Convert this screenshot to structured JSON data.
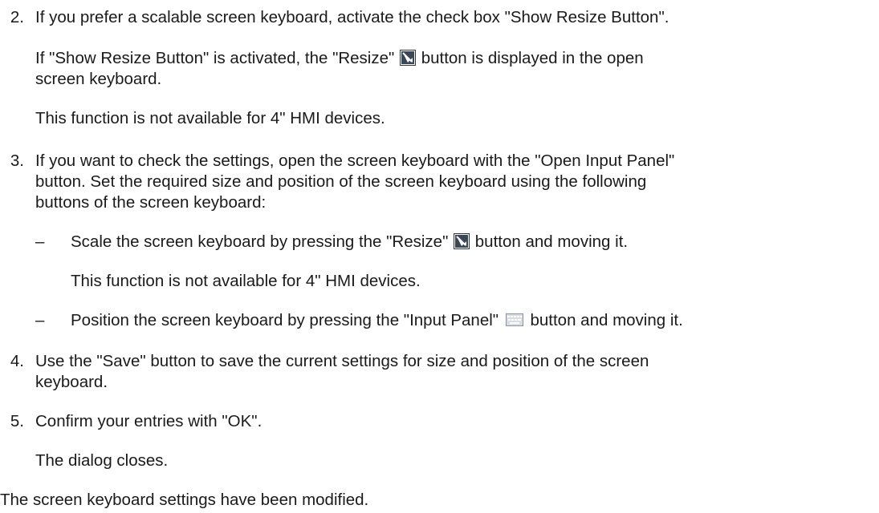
{
  "step2": {
    "number": "2.",
    "line1": "If you prefer a scalable screen keyboard, activate the check box \"Show Resize Button\".",
    "para1_before": "If \"Show Resize Button\" is activated, the \"Resize\"",
    "para1_after": "button is displayed in the open",
    "para1_line2": "screen keyboard.",
    "note": "This function is not available for 4\" HMI devices."
  },
  "step3": {
    "number": "3.",
    "line1": "If you want to check the settings, open the screen keyboard with the \"Open Input Panel\"",
    "line2": "button. Set the required size and position of the screen keyboard using the following",
    "line3": "buttons of the screen keyboard:",
    "bullet1_dash": "–",
    "bullet1_before": "Scale the screen keyboard by pressing the \"Resize\"",
    "bullet1_after": "button and moving it.",
    "bullet1_note": "This function is not available for 4\" HMI devices.",
    "bullet2_dash": "–",
    "bullet2_before": "Position the screen keyboard by pressing the \"Input Panel\"",
    "bullet2_after": "button and moving it."
  },
  "step4": {
    "number": "4.",
    "line1": "Use the \"Save\" button to save the current settings for size and position of the screen",
    "line2": "keyboard."
  },
  "step5": {
    "number": "5.",
    "line1": "Confirm your entries with \"OK\".",
    "result": "The dialog closes."
  },
  "conclusion": "The screen keyboard settings have been modified.",
  "icons": {
    "resize": "resize-icon",
    "input_panel": "keyboard-icon"
  },
  "colors": {
    "text": "#1a1a1a",
    "icon_dark": "#2b3744"
  }
}
